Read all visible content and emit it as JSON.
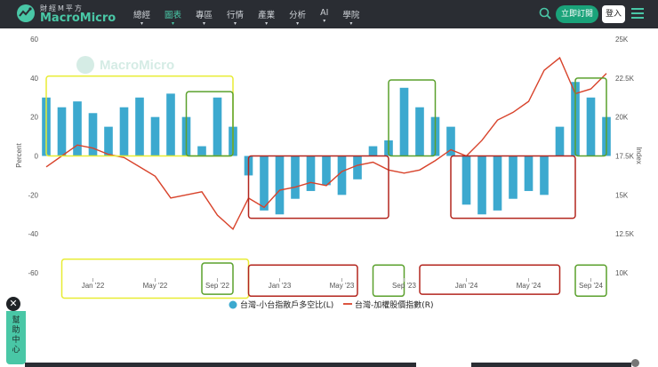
{
  "header": {
    "brand_small": "財經M平方",
    "brand_main": "MacroMicro",
    "nav": [
      "總經",
      "圖表",
      "專區",
      "行情",
      "產業",
      "分析",
      "AI",
      "學院"
    ],
    "active_nav": "圖表",
    "subscribe_label": "立即訂閱",
    "login_label": "登入"
  },
  "watermark": "MacroMicro",
  "help": {
    "close": "✕",
    "label": "幫助中心"
  },
  "chart_data": {
    "type": "bar+line",
    "y_left": {
      "label": "Percent",
      "ticks": [
        60,
        40,
        20,
        0,
        -20,
        -40,
        -60
      ],
      "range": [
        -60,
        60
      ]
    },
    "y_right": {
      "label": "Index",
      "ticks": [
        "25K",
        "22.5K",
        "20K",
        "17.5K",
        "15K",
        "12.5K",
        "10K"
      ],
      "range": [
        10000,
        25000
      ]
    },
    "x_ticks": [
      "Jan '22",
      "May '22",
      "Sep '22",
      "Jan '23",
      "May '23",
      "Sep '23",
      "Jan '24",
      "May '24",
      "Sep '24"
    ],
    "x_range": [
      "2021-10",
      "2024-10"
    ],
    "legend_position": "bottom",
    "series": [
      {
        "name": "台灣-小台指散戶多空比(L)",
        "type": "bar",
        "color": "#3ca9cf",
        "x": [
          "Oct '21",
          "Nov '21",
          "Dec '21",
          "Jan '22",
          "Feb '22",
          "Mar '22",
          "Apr '22",
          "May '22",
          "Jun '22",
          "Jul '22",
          "Aug '22",
          "Sep '22",
          "Oct '22",
          "Nov '22",
          "Dec '22",
          "Jan '23",
          "Feb '23",
          "Mar '23",
          "Apr '23",
          "May '23",
          "Jun '23",
          "Jul '23",
          "Aug '23",
          "Sep '23",
          "Oct '23",
          "Nov '23",
          "Dec '23",
          "Jan '24",
          "Feb '24",
          "Mar '24",
          "Apr '24",
          "May '24",
          "Jun '24",
          "Jul '24",
          "Aug '24",
          "Sep '24",
          "Oct '24"
        ],
        "values": [
          30,
          25,
          28,
          22,
          15,
          25,
          30,
          20,
          32,
          20,
          5,
          30,
          15,
          -10,
          -28,
          -30,
          -22,
          -18,
          -15,
          -20,
          -12,
          5,
          8,
          35,
          25,
          20,
          15,
          -25,
          -30,
          -28,
          -22,
          -18,
          -20,
          15,
          38,
          30,
          20
        ]
      },
      {
        "name": "台灣-加權股價指數(R)",
        "type": "line",
        "color": "#d8432b",
        "x": [
          "Oct '21",
          "Nov '21",
          "Dec '21",
          "Jan '22",
          "Feb '22",
          "Mar '22",
          "Apr '22",
          "May '22",
          "Jun '22",
          "Jul '22",
          "Aug '22",
          "Sep '22",
          "Oct '22",
          "Nov '22",
          "Dec '22",
          "Jan '23",
          "Feb '23",
          "Mar '23",
          "Apr '23",
          "May '23",
          "Jun '23",
          "Jul '23",
          "Aug '23",
          "Sep '23",
          "Oct '23",
          "Nov '23",
          "Dec '23",
          "Jan '24",
          "Feb '24",
          "Mar '24",
          "Apr '24",
          "May '24",
          "Jun '24",
          "Jul '24",
          "Aug '24",
          "Sep '24",
          "Oct '24"
        ],
        "values": [
          16800,
          17500,
          18200,
          18000,
          17600,
          17400,
          16800,
          16200,
          14800,
          15000,
          15200,
          13700,
          12800,
          14800,
          14200,
          15300,
          15500,
          15800,
          15600,
          16500,
          16900,
          17100,
          16600,
          16400,
          16600,
          17200,
          17900,
          17500,
          18500,
          19800,
          20300,
          21000,
          23000,
          23800,
          21500,
          21800,
          22800
        ]
      }
    ],
    "annotation_boxes": [
      {
        "color": "#e8ec33",
        "x_from": "Oct '21",
        "x_to": "Oct '22",
        "y_from": 0,
        "y_to": 41
      },
      {
        "color": "#5aa02c",
        "x_from": "Jul '22",
        "x_to": "Oct '22",
        "y_from": 0,
        "y_to": 33
      },
      {
        "color": "#b3261e",
        "x_from": "Nov '22",
        "x_to": "Aug '23",
        "y_from": -32,
        "y_to": 0
      },
      {
        "color": "#5aa02c",
        "x_from": "Aug '23",
        "x_to": "Nov '23",
        "y_from": 0,
        "y_to": 39
      },
      {
        "color": "#b3261e",
        "x_from": "Dec '23",
        "x_to": "Aug '24",
        "y_from": -32,
        "y_to": 0
      },
      {
        "color": "#5aa02c",
        "x_from": "Aug '24",
        "x_to": "Oct '24",
        "y_from": 0,
        "y_to": 40
      },
      {
        "color": "#e8ec33",
        "x_from": "Nov '21",
        "x_to": "Nov '22",
        "y_from": -53,
        "y_to": -73
      },
      {
        "color": "#5aa02c",
        "x_from": "Aug '22",
        "x_to": "Oct '22",
        "y_from": -55,
        "y_to": -71
      },
      {
        "color": "#b3261e",
        "x_from": "Nov '22",
        "x_to": "Jun '23",
        "y_from": -56,
        "y_to": -72
      },
      {
        "color": "#5aa02c",
        "x_from": "Jul '23",
        "x_to": "Sep '23",
        "y_from": -56,
        "y_to": -72
      },
      {
        "color": "#b3261e",
        "x_from": "Oct '23",
        "x_to": "Jul '24",
        "y_from": -56,
        "y_to": -71
      },
      {
        "color": "#5aa02c",
        "x_from": "Aug '24",
        "x_to": "Oct '24",
        "y_from": -56,
        "y_to": -72
      }
    ]
  }
}
